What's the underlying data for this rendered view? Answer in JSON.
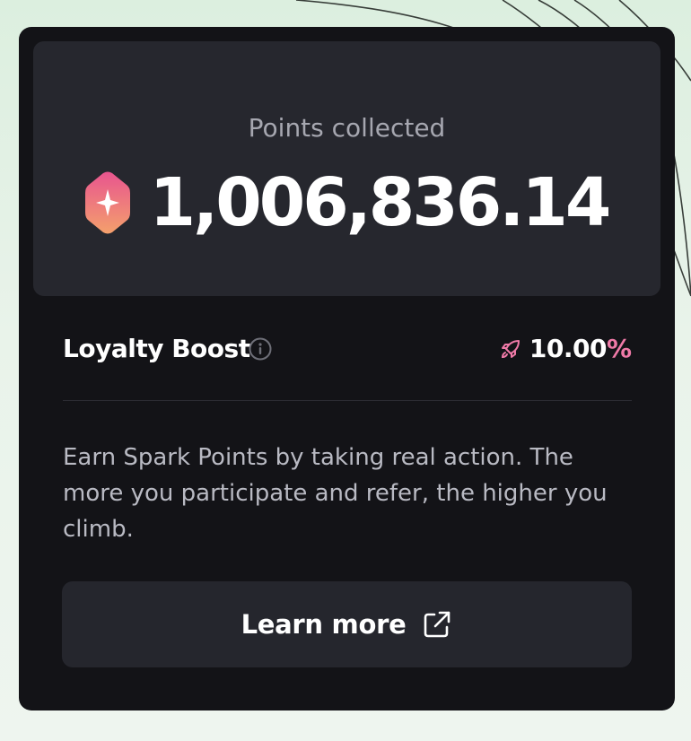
{
  "card": {
    "points_label": "Points collected",
    "points_value": "1,006,836.14",
    "boost_title": "Loyalty Boost",
    "boost_value": "10.00",
    "boost_unit": "%",
    "description": "Earn Spark Points by taking real action. The more you participate and refer, the higher you climb.",
    "button_label": "Learn more"
  },
  "icons": {
    "gem": "spark-gem-icon",
    "info": "info-icon",
    "rocket": "rocket-icon",
    "external": "external-link-icon"
  },
  "colors": {
    "background": "#dcefdf",
    "card": "#131317",
    "panel": "#26272e",
    "button": "#25262d",
    "accent_pink": "#f07aa8",
    "text_muted": "#a6a7b0",
    "text_body": "#b9bac3"
  }
}
